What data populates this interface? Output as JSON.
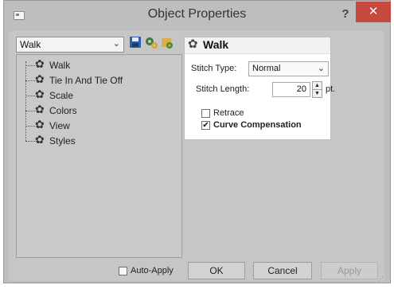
{
  "window": {
    "title": "Object Properties",
    "help_glyph": "?",
    "close_glyph": "✕"
  },
  "toolbar": {
    "object_select_value": "Walk",
    "chevron_glyph": "⌄",
    "icons": [
      "save-icon",
      "gears-icon",
      "object-gear-icon"
    ]
  },
  "tree": {
    "items": [
      {
        "label": "Walk"
      },
      {
        "label": "Tie In And Tie Off"
      },
      {
        "label": "Scale"
      },
      {
        "label": "Colors"
      },
      {
        "label": "View"
      },
      {
        "label": "Styles"
      }
    ]
  },
  "panel": {
    "title": "Walk",
    "stitch_type_label": "Stitch Type:",
    "stitch_type_value": "Normal",
    "stitch_length_label": "Stitch Length:",
    "stitch_length_value": "20",
    "stitch_length_unit": "pt.",
    "retrace_label": "Retrace",
    "retrace_checked": false,
    "curve_comp_label": "Curve Compensation",
    "curve_comp_checked": true
  },
  "footer": {
    "auto_apply_label": "Auto-Apply",
    "auto_apply_checked": false,
    "ok_label": "OK",
    "cancel_label": "Cancel",
    "apply_label": "Apply"
  },
  "colors": {
    "close_button": "#c7493d",
    "dialog_bg": "#c6c6c6"
  }
}
